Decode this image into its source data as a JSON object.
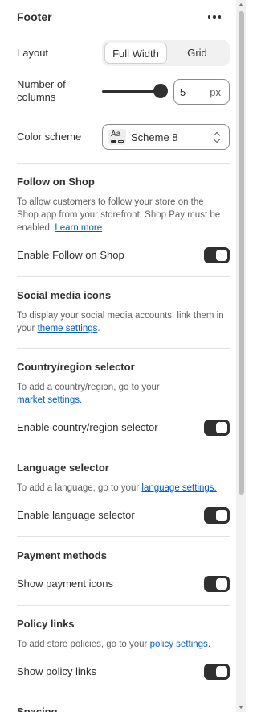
{
  "header": {
    "title": "Footer",
    "more_icon": "more-horizontal-icon"
  },
  "layout": {
    "label": "Layout",
    "options": [
      "Full Width",
      "Grid"
    ],
    "selected": "Full Width"
  },
  "columns": {
    "label_line1": "Number of",
    "label_line2": "columns",
    "value": "5",
    "unit": "px",
    "slider_fraction": 1.0
  },
  "color_scheme": {
    "label": "Color scheme",
    "icon_text": "Aa",
    "value": "Scheme 8"
  },
  "follow_shop": {
    "title": "Follow on Shop",
    "desc_line1": "To allow customers to follow your store on the",
    "desc_line2": "Shop app from your storefront, Shop Pay must be",
    "desc_line3": "enabled.",
    "link": "Learn more",
    "toggle_label": "Enable Follow on Shop",
    "toggle_on": true
  },
  "social": {
    "title": "Social media icons",
    "desc_line1": "To display your social media accounts, link them in",
    "desc_line2_prefix": "your",
    "link": "theme settings",
    "desc_suffix": "."
  },
  "country": {
    "title": "Country/region selector",
    "desc_line1": "To add a country/region, go to your",
    "link": "market settings.",
    "toggle_label": "Enable country/region selector",
    "toggle_on": true
  },
  "language": {
    "title": "Language selector",
    "desc_prefix": "To add a language, go to your",
    "link": "language settings.",
    "toggle_label": "Enable language selector",
    "toggle_on": true
  },
  "payment": {
    "title": "Payment methods",
    "toggle_label": "Show payment icons",
    "toggle_on": true
  },
  "policy": {
    "title": "Policy links",
    "desc_prefix": "To add store policies, go to your",
    "link": "policy settings",
    "desc_suffix": ".",
    "toggle_label": "Show policy links",
    "toggle_on": true
  },
  "spacing": {
    "title": "Spacing"
  },
  "colors": {
    "text": "#303030",
    "muted": "#616161",
    "link": "#005bd3",
    "toggle": "#303030",
    "divider": "#e3e3e3"
  }
}
